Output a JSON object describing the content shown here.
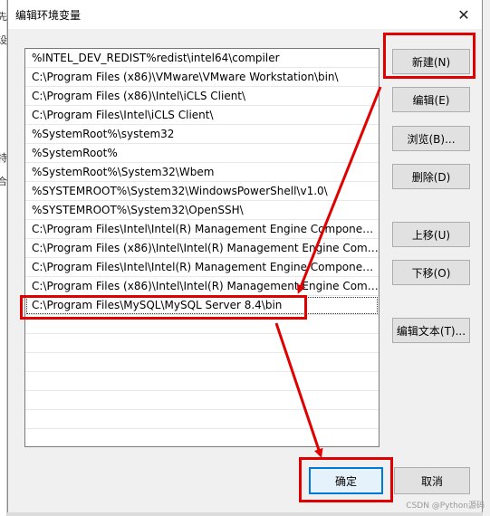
{
  "dialog": {
    "title": "编辑环境变量",
    "close_glyph": "✕"
  },
  "background_window": {
    "glyphs": [
      "先",
      "设",
      "特",
      "合"
    ]
  },
  "path_list": {
    "items": [
      "%INTEL_DEV_REDIST%redist\\intel64\\compiler",
      "C:\\Program Files (x86)\\VMware\\VMware Workstation\\bin\\",
      "C:\\Program Files (x86)\\Intel\\iCLS Client\\",
      "C:\\Program Files\\Intel\\iCLS Client\\",
      "%SystemRoot%\\system32",
      "%SystemRoot%",
      "%SystemRoot%\\System32\\Wbem",
      "%SYSTEMROOT%\\System32\\WindowsPowerShell\\v1.0\\",
      "%SYSTEMROOT%\\System32\\OpenSSH\\",
      "C:\\Program Files\\Intel\\Intel(R) Management Engine Component...",
      "C:\\Program Files (x86)\\Intel\\Intel(R) Management Engine Comp...",
      "C:\\Program Files\\Intel\\Intel(R) Management Engine Component...",
      "C:\\Program Files (x86)\\Intel\\Intel(R) Management Engine Comp...",
      "C:\\Program Files\\MySQL\\MySQL Server 8.4\\bin"
    ],
    "selected_index": 13
  },
  "buttons": {
    "new": "新建(N)",
    "edit": "编辑(E)",
    "browse": "浏览(B)...",
    "delete": "删除(D)",
    "move_up": "上移(U)",
    "move_down": "下移(O)",
    "edit_text": "编辑文本(T)...",
    "ok": "确定",
    "cancel": "取消"
  },
  "annotation_color": "#e00000",
  "watermark": "CSDN @Python源码"
}
